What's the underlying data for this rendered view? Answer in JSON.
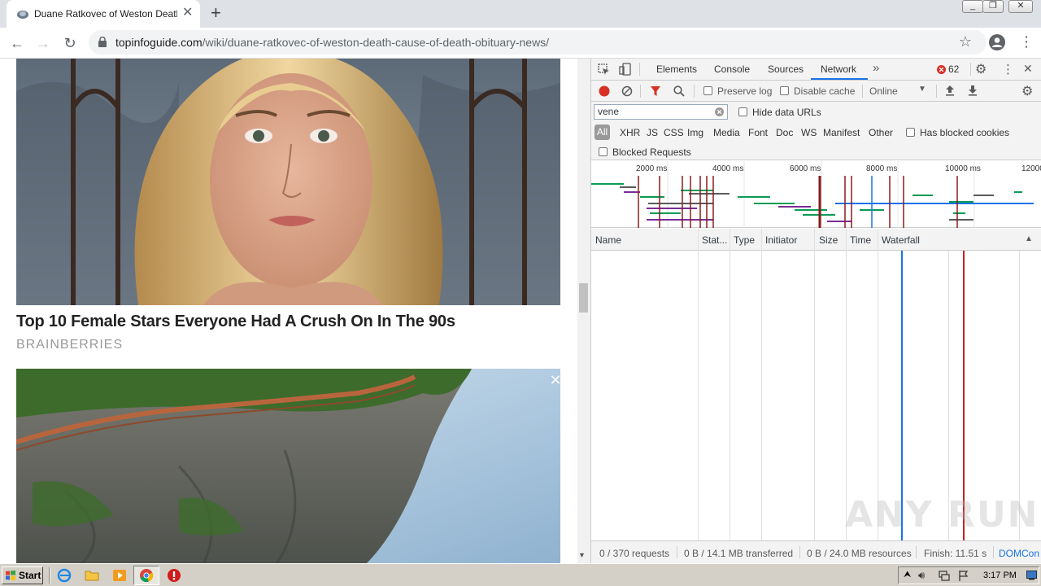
{
  "browser": {
    "tab_title": "Duane Ratkovec of Weston Death -",
    "url_host": "topinfoguide.com",
    "url_path": "/wiki/duane-ratkovec-of-weston-death-cause-of-death-obituary-news/"
  },
  "page": {
    "article_headline": "Top 10 Female Stars Everyone Had A Crush On In The 90s",
    "article_source": "BRAINBERRIES"
  },
  "devtools": {
    "tabs": [
      "Elements",
      "Console",
      "Sources",
      "Network"
    ],
    "active_tab": "Network",
    "error_count": "62",
    "toolbar": {
      "preserve_log": "Preserve log",
      "disable_cache": "Disable cache",
      "throttle": "Online"
    },
    "filter": {
      "value": "vene",
      "hide_data_urls": "Hide data URLs",
      "types": [
        "All",
        "XHR",
        "JS",
        "CSS",
        "Img",
        "Media",
        "Font",
        "Doc",
        "WS",
        "Manifest",
        "Other"
      ],
      "has_blocked_cookies": "Has blocked cookies",
      "blocked_requests": "Blocked Requests"
    },
    "overview_ticks": [
      "2000 ms",
      "4000 ms",
      "6000 ms",
      "8000 ms",
      "10000 ms",
      "12000"
    ],
    "columns": [
      "Name",
      "Stat...",
      "Type",
      "Initiator",
      "Size",
      "Time",
      "Waterfall"
    ],
    "status": {
      "requests": "0 / 370 requests",
      "transferred": "0 B / 14.1 MB transferred",
      "resources": "0 B / 24.0 MB resources",
      "finish": "Finish: 11.51 s",
      "domcontent": "DOMCon"
    }
  },
  "watermark": "ANY RUN",
  "taskbar": {
    "start_label": "Start",
    "clock": "3:17 PM"
  },
  "colors": {
    "record": "#d93025",
    "domcontentloaded": "#1a73e8",
    "load": "#c5221f",
    "link": "#1a73e8"
  }
}
